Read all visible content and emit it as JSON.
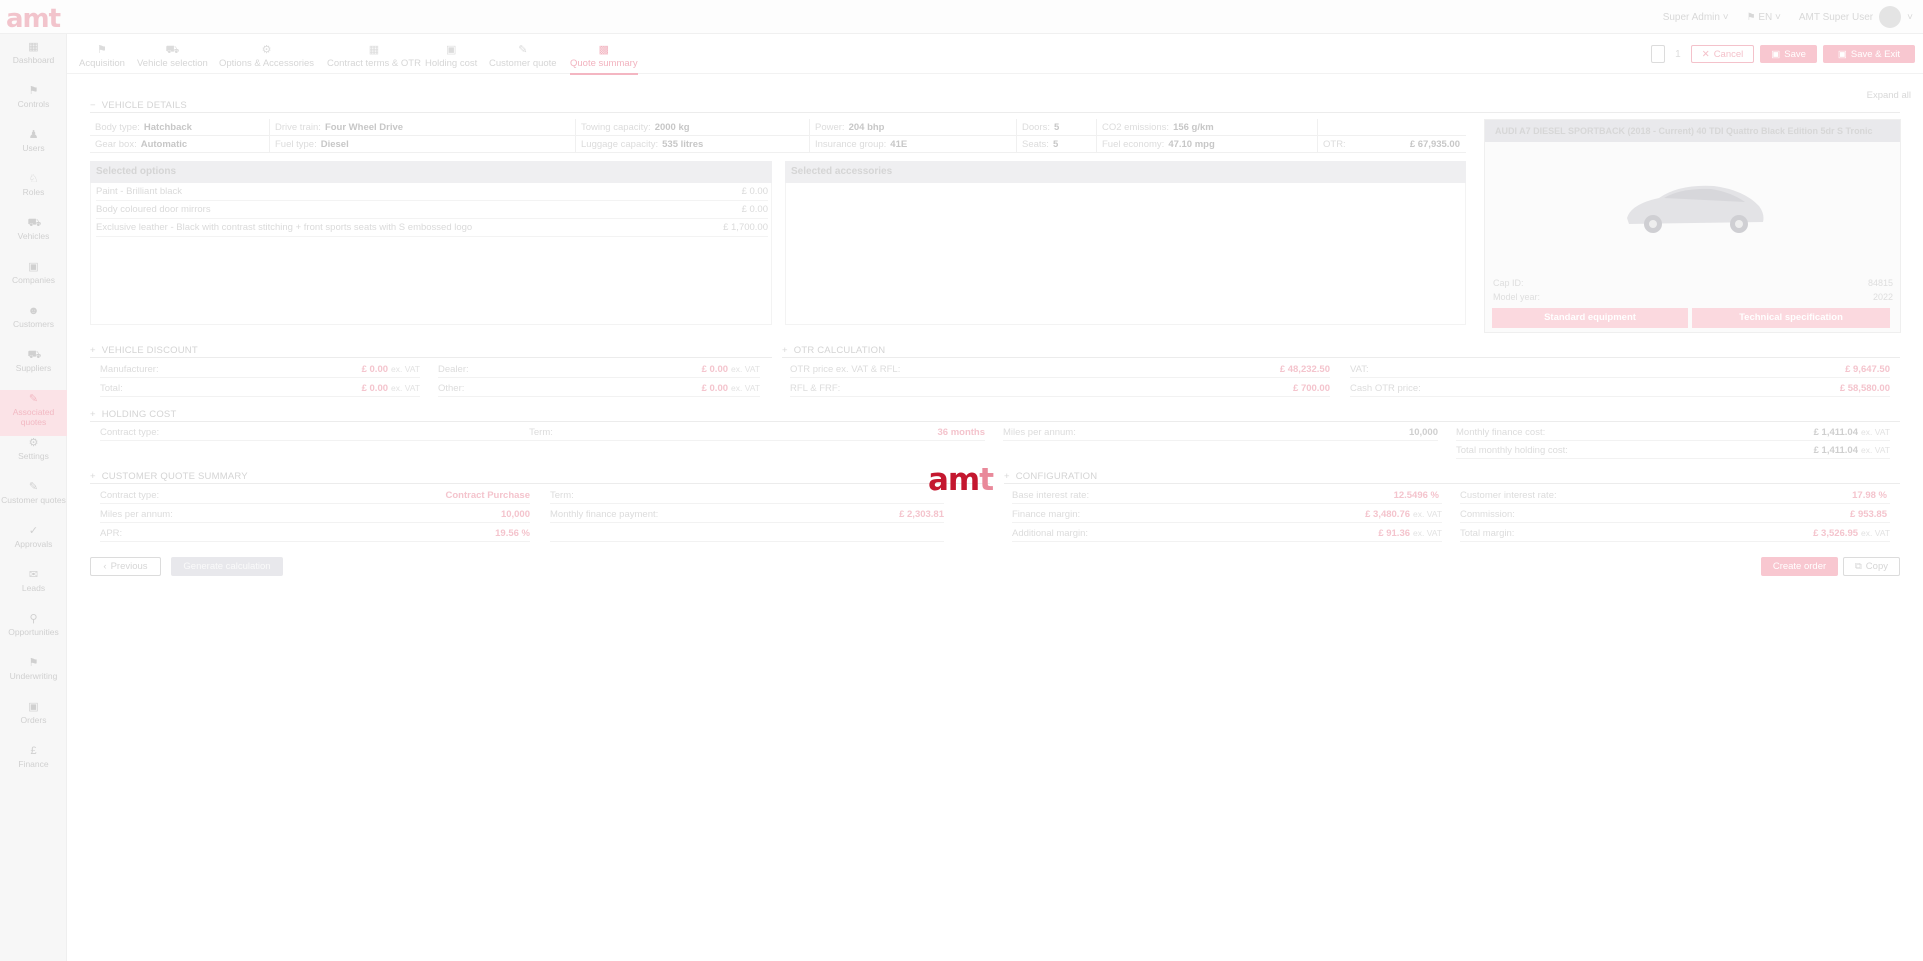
{
  "app": {
    "logo": "amt"
  },
  "topbar": {
    "role": "Super Admin",
    "lang": "EN",
    "user": "AMT Super User"
  },
  "sidebar": [
    {
      "label": "Dashboard",
      "icon": "dashboard-icon",
      "active": false
    },
    {
      "label": "Controls",
      "icon": "controls-icon",
      "active": false
    },
    {
      "label": "Users",
      "icon": "users-icon",
      "active": false
    },
    {
      "label": "Roles",
      "icon": "roles-icon",
      "active": false
    },
    {
      "label": "Vehicles",
      "icon": "vehicles-icon",
      "active": false
    },
    {
      "label": "Companies",
      "icon": "companies-icon",
      "active": false
    },
    {
      "label": "Customers",
      "icon": "customers-icon",
      "active": false
    },
    {
      "label": "Suppliers",
      "icon": "suppliers-icon",
      "active": false
    },
    {
      "label": "Associated quotes",
      "icon": "quotes-icon",
      "active": true
    },
    {
      "label": "Settings",
      "icon": "settings-icon",
      "active": false
    },
    {
      "label": "Customer quotes",
      "icon": "customer-quotes-icon",
      "active": false
    },
    {
      "label": "Approvals",
      "icon": "approvals-icon",
      "active": false
    },
    {
      "label": "Leads",
      "icon": "leads-icon",
      "active": false
    },
    {
      "label": "Opportunities",
      "icon": "opportunities-icon",
      "active": false
    },
    {
      "label": "Underwriting",
      "icon": "underwriting-icon",
      "active": false
    },
    {
      "label": "Orders",
      "icon": "orders-icon",
      "active": false
    },
    {
      "label": "Finance",
      "icon": "finance-icon",
      "active": false
    }
  ],
  "tabs": [
    {
      "label": "Acquisition",
      "active": false
    },
    {
      "label": "Vehicle selection",
      "active": false
    },
    {
      "label": "Options & Accessories",
      "active": false
    },
    {
      "label": "Contract terms & OTR",
      "active": false
    },
    {
      "label": "Holding cost",
      "active": false
    },
    {
      "label": "Customer quote",
      "active": false
    },
    {
      "label": "Quote summary",
      "active": true
    }
  ],
  "actions": {
    "page_count": "1",
    "cancel": "Cancel",
    "save": "Save",
    "save_exit": "Save & Exit"
  },
  "expand_all": "Expand all",
  "vehicle_details": {
    "title": "VEHICLE DETAILS",
    "row1": [
      {
        "k": "Body type:",
        "v": "Hatchback"
      },
      {
        "k": "Drive train:",
        "v": "Four Wheel Drive"
      },
      {
        "k": "Towing capacity:",
        "v": "2000 kg"
      },
      {
        "k": "Power:",
        "v": "204 bhp"
      },
      {
        "k": "Doors:",
        "v": "5"
      },
      {
        "k": "CO2 emissions:",
        "v": "156 g/km"
      },
      {
        "k": "",
        "v": ""
      }
    ],
    "row2": [
      {
        "k": "Gear box:",
        "v": "Automatic"
      },
      {
        "k": "Fuel type:",
        "v": "Diesel"
      },
      {
        "k": "Luggage capacity:",
        "v": "535 litres"
      },
      {
        "k": "Insurance group:",
        "v": "41E"
      },
      {
        "k": "Seats:",
        "v": "5"
      },
      {
        "k": "Fuel economy:",
        "v": "47.10 mpg"
      },
      {
        "k": "OTR:",
        "v": "£ 67,935.00"
      }
    ]
  },
  "selected_options": {
    "title": "Selected options",
    "items": [
      {
        "name": "Paint - Brilliant black",
        "price": "£ 0.00"
      },
      {
        "name": "Body coloured door mirrors",
        "price": "£ 0.00"
      },
      {
        "name": "Exclusive leather - Black with contrast stitching + front sports seats with S embossed logo",
        "price": "£ 1,700.00"
      }
    ]
  },
  "selected_accessories": {
    "title": "Selected accessories"
  },
  "car": {
    "title": "AUDI A7 DIESEL SPORTBACK (2018 - Current) 40 TDI Quattro Black Edition 5dr S Tronic",
    "cap_id": "Cap ID:",
    "cap_id_val": "84815",
    "model_year": "Model year:",
    "model_year_val": "2022",
    "btn_standard": "Standard equipment",
    "btn_tech": "Technical specification"
  },
  "vehicle_discount": {
    "title": "VEHICLE DISCOUNT",
    "rows": [
      {
        "k": "Manufacturer:",
        "v": "£ 0.00",
        "s": "ex. VAT",
        "k2": "Dealer:",
        "v2": "£ 0.00",
        "s2": "ex. VAT"
      },
      {
        "k": "Total:",
        "v": "£ 0.00",
        "s": "ex. VAT",
        "k2": "Other:",
        "v2": "£ 0.00",
        "s2": "ex. VAT"
      }
    ]
  },
  "otr_calculation": {
    "title": "OTR CALCULATION",
    "rows": [
      {
        "k": "OTR price ex. VAT & RFL:",
        "v": "£ 48,232.50",
        "k2": "VAT:",
        "v2": "£ 9,647.50"
      },
      {
        "k": "RFL & FRF:",
        "v": "£ 700.00",
        "k2": "Cash OTR price:",
        "v2": "£ 58,580.00"
      }
    ]
  },
  "holding_cost": {
    "title": "HOLDING COST",
    "contract_type": "Contract type:",
    "term": "Term:",
    "term_val": "36 months",
    "miles": "Miles per annum:",
    "miles_val": "10,000",
    "monthly": "Monthly finance cost:",
    "monthly_val": "£ 1,411.04",
    "monthly_s": "ex. VAT",
    "total": "Total monthly holding cost:",
    "total_val": "£ 1,411.04",
    "total_s": "ex. VAT"
  },
  "customer_quote_summary": {
    "title": "CUSTOMER QUOTE SUMMARY",
    "rows": [
      {
        "k": "Contract type:",
        "v": "Contract Purchase",
        "k2": "Term:",
        "v2": ""
      },
      {
        "k": "Miles per annum:",
        "v": "10,000",
        "k2": "Monthly finance payment:",
        "v2": "£ 2,303.81"
      },
      {
        "k": "APR:",
        "v": "19.56 %",
        "k2": "",
        "v2": ""
      }
    ]
  },
  "configuration": {
    "title": "CONFIGURATION",
    "rows": [
      {
        "k": "Base interest rate:",
        "v": "12.5496 %",
        "s": "",
        "k2": "Customer interest rate:",
        "v2": "17.98 %",
        "s2": ""
      },
      {
        "k": "Finance margin:",
        "v": "£ 3,480.76",
        "s": "ex. VAT",
        "k2": "Commission:",
        "v2": "£ 953.85",
        "s2": ""
      },
      {
        "k": "Additional margin:",
        "v": "£ 91.36",
        "s": "ex. VAT",
        "k2": "Total margin:",
        "v2": "£ 3,526.95",
        "s2": "ex. VAT"
      }
    ]
  },
  "footer": {
    "previous": "Previous",
    "calculation": "Generate calculation",
    "create_order": "Create order",
    "copy": "Copy"
  },
  "overlay_logo": {
    "main": "am",
    "accent": "t"
  }
}
